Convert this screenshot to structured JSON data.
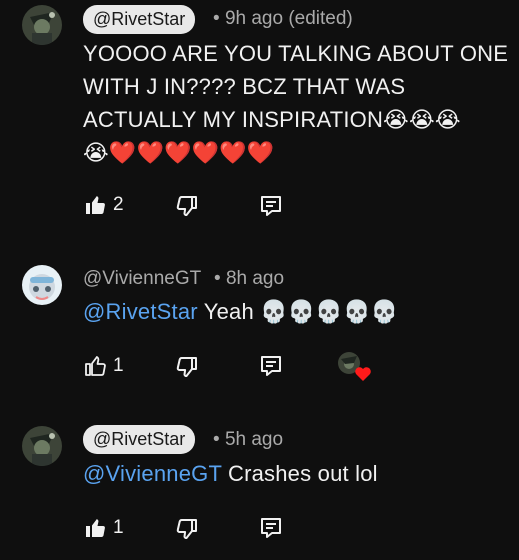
{
  "comments": [
    {
      "author": "@RivetStar",
      "author_style": "chip",
      "time": "9h ago (edited)",
      "text": "YOOOO ARE YOU TALKING ABOUT ONE\nWITH J IN???? BCZ THAT WAS\nACTUALLY MY INSPIRATION😭😭😭\n😭❤️❤️❤️❤️❤️❤️",
      "likes": "2",
      "liked": true
    },
    {
      "author": "@VivienneGT",
      "author_style": "plain",
      "time": "8h ago",
      "mention": "@RivetStar",
      "text": "Yeah 💀💀💀💀💀",
      "likes": "1",
      "liked": false,
      "creator_heart": true
    },
    {
      "author": "@RivetStar",
      "author_style": "chip",
      "time": "5h ago",
      "mention": "@VivienneGT",
      "text": "Crashes out lol",
      "likes": "1",
      "liked": true
    }
  ],
  "icons": {
    "like": "thumbs-up-icon",
    "dislike": "thumbs-down-icon",
    "reply": "reply-icon",
    "heart": "heart-icon"
  },
  "colors": {
    "background": "#0f0f0f",
    "mention": "#5aa3f0",
    "chip": "#e9e9e9",
    "heart": "#ff1a1a"
  }
}
